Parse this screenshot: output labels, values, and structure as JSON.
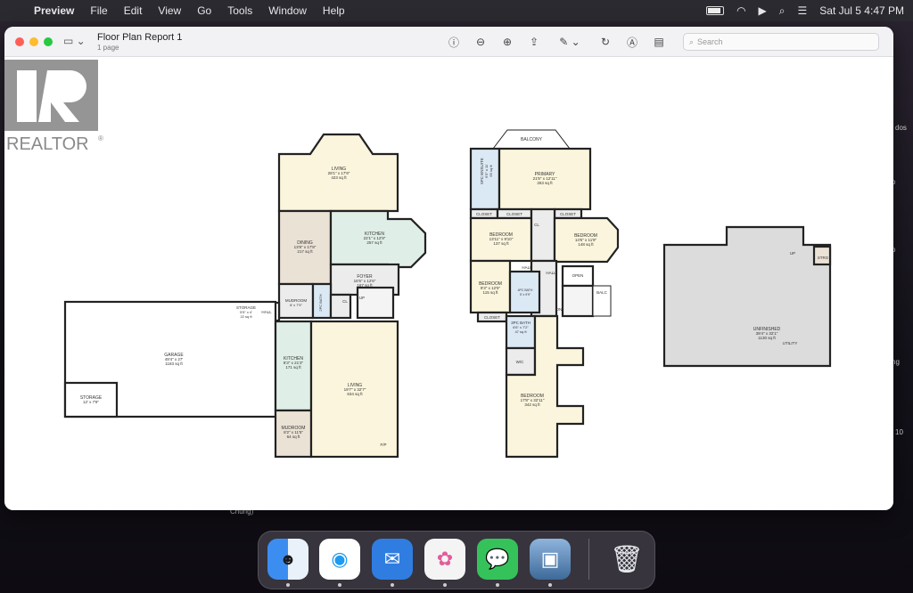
{
  "menubar": {
    "items": [
      "Preview",
      "File",
      "Edit",
      "View",
      "Go",
      "Tools",
      "Window",
      "Help"
    ],
    "datetime": "Sat Jul 5  4:47 PM"
  },
  "window": {
    "title": "Floor Plan Report 1",
    "subtitle": "1 page",
    "search_placeholder": "Search"
  },
  "watermark": {
    "text": "REALTOR",
    "mark": "®"
  },
  "floorplan": {
    "main": {
      "living_top": {
        "name": "LIVING",
        "dims": "28'1\" x 17'9\"",
        "area": "423 sq ft"
      },
      "dining": {
        "name": "DINING",
        "dims": "13'8\" x 17'8\"",
        "area": "217 sq ft"
      },
      "kitchen_top": {
        "name": "KITCHEN",
        "dims": "22'1\" x 12'9\"",
        "area": "257 sq ft"
      },
      "foyer": {
        "name": "FOYER",
        "dims": "16'5\" x 12'6\"",
        "area": "167 sq ft"
      },
      "mudroom_top": {
        "name": "MUDROOM",
        "dims": "8' x 7'9\""
      },
      "bath_2pc": {
        "name": "2PC BATH"
      },
      "cl": "CL",
      "up": "UP",
      "storage_small": {
        "name": "STORAGE",
        "dims": "5'5\" x 4'",
        "area": "22 sq ft"
      },
      "hall": "HALL",
      "garage": {
        "name": "GARAGE",
        "dims": "49'4\" x 27'",
        "area": "1183 sq ft"
      },
      "storage_garage": {
        "name": "STORAGE",
        "dims": "12' x 7'9\""
      },
      "kitchen_low": {
        "name": "KITCHEN",
        "dims": "8'3\" x 21'3\"",
        "area": "171 sq ft"
      },
      "mudroom_low": {
        "name": "MUDROOM",
        "dims": "8'2\" x 11'5\"",
        "area": "64 sq ft"
      },
      "living_low": {
        "name": "LIVING",
        "dims": "19'7\" x 32'7\"",
        "area": "634 sq ft"
      },
      "fp": "F/P"
    },
    "upper": {
      "balcony": "BALCONY",
      "ensuite": {
        "name": "5PC ENSUITE",
        "dims": "6'5\" x 11'",
        "area": "65 sq ft"
      },
      "primary": {
        "name": "PRIMARY",
        "dims": "21'5\" x 12'11\"",
        "area": "263 sq ft"
      },
      "closet_1": "CLOSET",
      "closet_2": "CLOSET",
      "closet_3": "CLOSET",
      "closet_4": "CLOSET",
      "cl": "CL",
      "bedroom_a": {
        "name": "BEDROOM",
        "dims": "13'11\" x 9'10\"",
        "area": "137 sq ft"
      },
      "bedroom_b": {
        "name": "BEDROOM",
        "dims": "14'5\" x 11'9\"",
        "area": "148 sq ft"
      },
      "hall_1": "HALL",
      "hall_2": "HALL",
      "open": "OPEN",
      "balc": "BALC",
      "dn": "DN",
      "bedroom_c": {
        "name": "BEDROOM",
        "dims": "9'3\" x 12'5\"",
        "area": "115 sq ft"
      },
      "bath_4pc_a": {
        "name": "4PC BATH",
        "dims": "5' x 9'9\""
      },
      "bath_3pc": {
        "name": "3PC BATH",
        "dims": "6'6\" x 7'2\"",
        "area": "47 sq ft"
      },
      "wic": "W/C",
      "bedroom_big": {
        "name": "BEDROOM",
        "dims": "17'8\" x 32'11\"",
        "area": "342 sq ft"
      }
    },
    "basement": {
      "unfinished": {
        "name": "UNFINISHED",
        "dims": "39'4\" x 32'1\"",
        "area": "1130 sq ft"
      },
      "utility": "UTILITY",
      "up": "UP",
      "strg": "STRG"
    }
  },
  "dock": {
    "apps": [
      {
        "name": "Finder",
        "icon": "finder-icon",
        "color": "#3b8ef0"
      },
      {
        "name": "Safari",
        "icon": "safari-icon",
        "color": "#1d9bf0"
      },
      {
        "name": "Mail",
        "icon": "mail-icon",
        "color": "#2f7de1"
      },
      {
        "name": "Photos",
        "icon": "photos-icon",
        "color": "#f4f4f4"
      },
      {
        "name": "Messages",
        "icon": "messages-icon",
        "color": "#36c25b"
      },
      {
        "name": "Preview",
        "icon": "preview-icon",
        "color": "#5f87b6"
      },
      {
        "name": "Trash",
        "icon": "trash-icon",
        "color": "#d9dde2"
      }
    ]
  },
  "peek_text": {
    "left_bottom": "Chung)",
    "right_1": "dos",
    "right_2": "o",
    "right_3": "o",
    "right_4": "ng",
    "right_5": "10"
  }
}
